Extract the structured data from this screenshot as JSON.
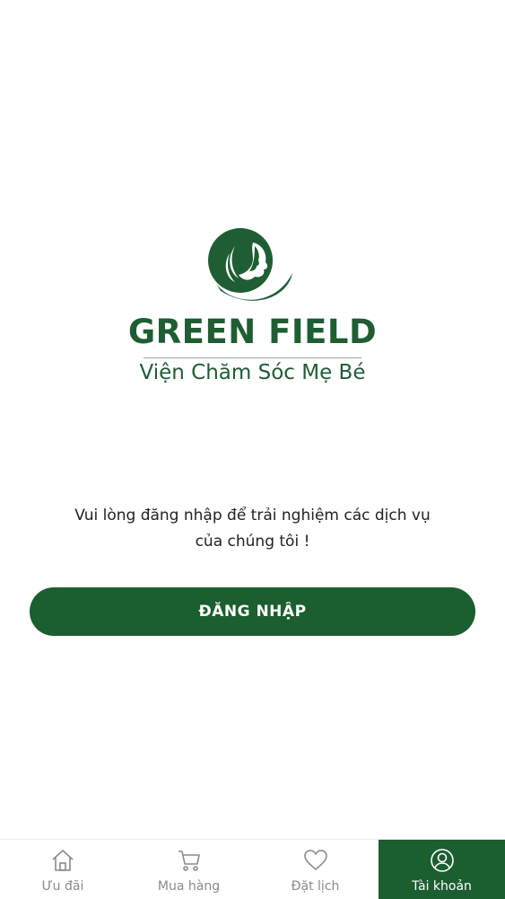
{
  "brand": {
    "name": "GREEN FIELD",
    "tagline": "Viện Chăm Sóc Mẹ Bé",
    "color": "#1e5e32"
  },
  "message": {
    "line1": "Vui lòng đăng nhập để trải nghiệm các dịch vụ",
    "line2": "của chúng tôi !"
  },
  "login": {
    "label": "ĐĂNG NHẬP",
    "color": "#1b5e30"
  },
  "tabbar": {
    "active_color": "#1b5e30",
    "items": [
      {
        "label": "Ưu đãi",
        "icon": "home-icon"
      },
      {
        "label": "Mua hàng",
        "icon": "cart-icon"
      },
      {
        "label": "Đặt lịch",
        "icon": "heart-icon"
      },
      {
        "label": "Tài khoản",
        "icon": "user-icon",
        "active": true
      }
    ]
  }
}
